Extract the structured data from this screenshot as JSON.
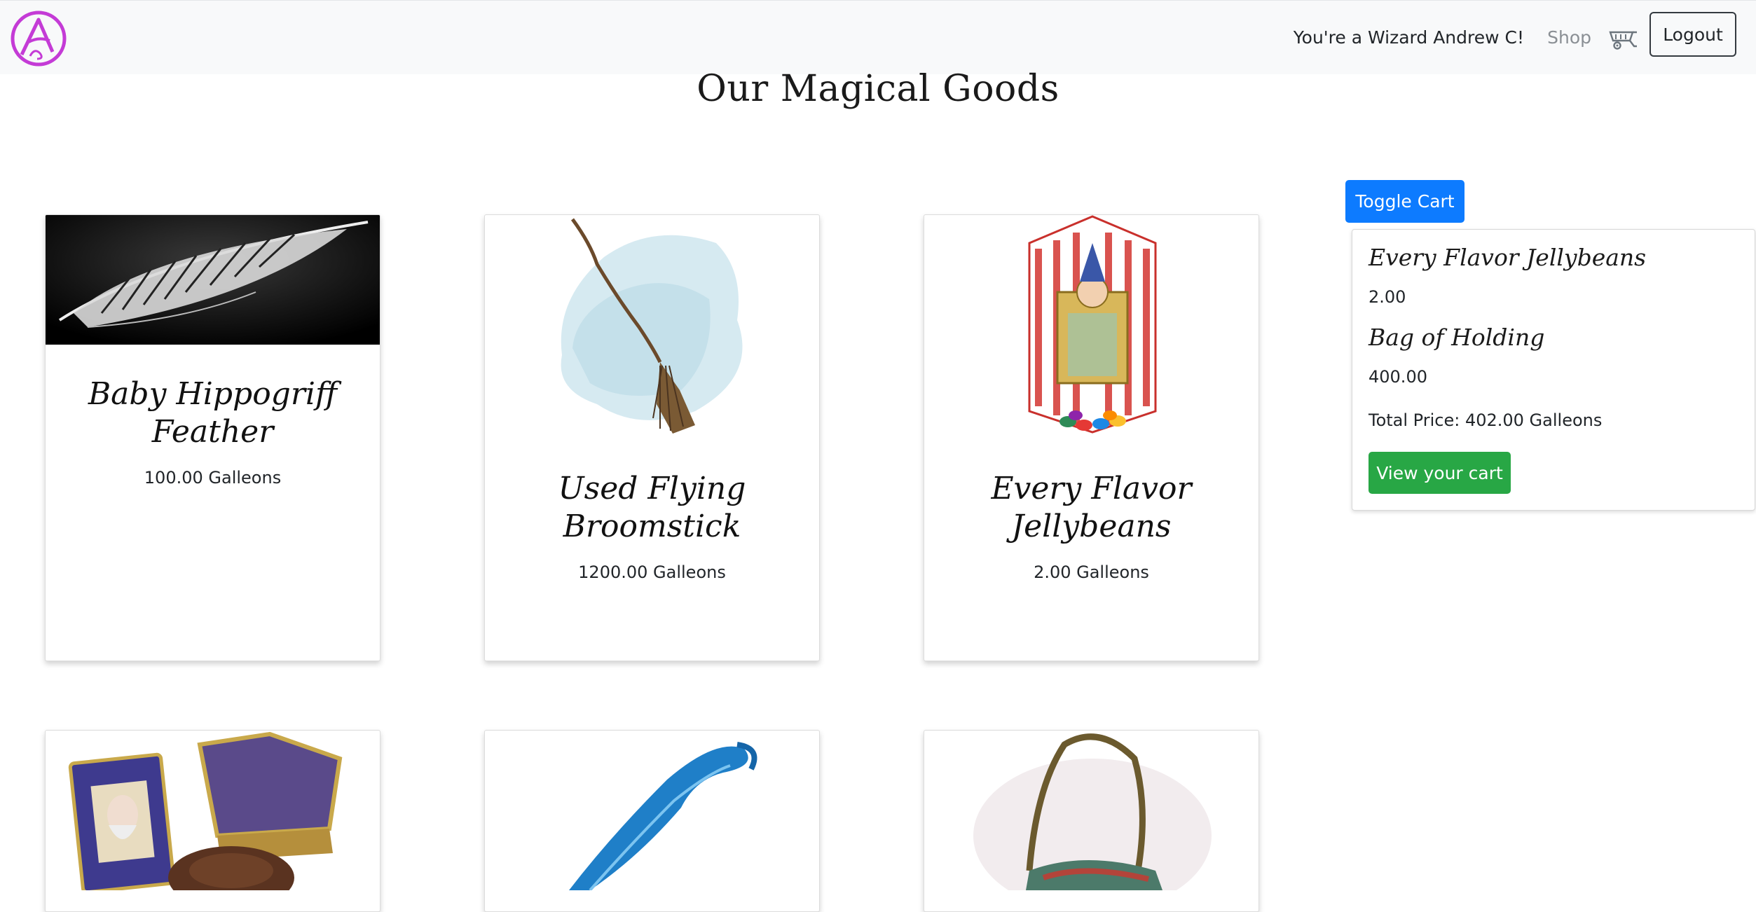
{
  "nav": {
    "greeting": "You're a Wizard Andrew C!",
    "shop": "Shop",
    "logout": "Logout"
  },
  "page": {
    "title": "Our Magical Goods"
  },
  "products": [
    {
      "title": "Baby Hippogriff Feather",
      "price": "100.00 Galleons"
    },
    {
      "title": "Used Flying Broomstick",
      "price": "1200.00 Galleons"
    },
    {
      "title": "Every Flavor Jellybeans",
      "price": "2.00 Galleons"
    }
  ],
  "cart": {
    "toggle_label": "Toggle Cart",
    "items": [
      {
        "name": "Every Flavor Jellybeans",
        "price": "2.00"
      },
      {
        "name": "Bag of Holding",
        "price": "400.00"
      }
    ],
    "total": "Total Price: 402.00 Galleons",
    "view_label": "View your cart"
  },
  "colors": {
    "primary": "#0d7bff",
    "success": "#28a745",
    "logo": "#c43bd6",
    "navbar": "#f8f9fa"
  }
}
